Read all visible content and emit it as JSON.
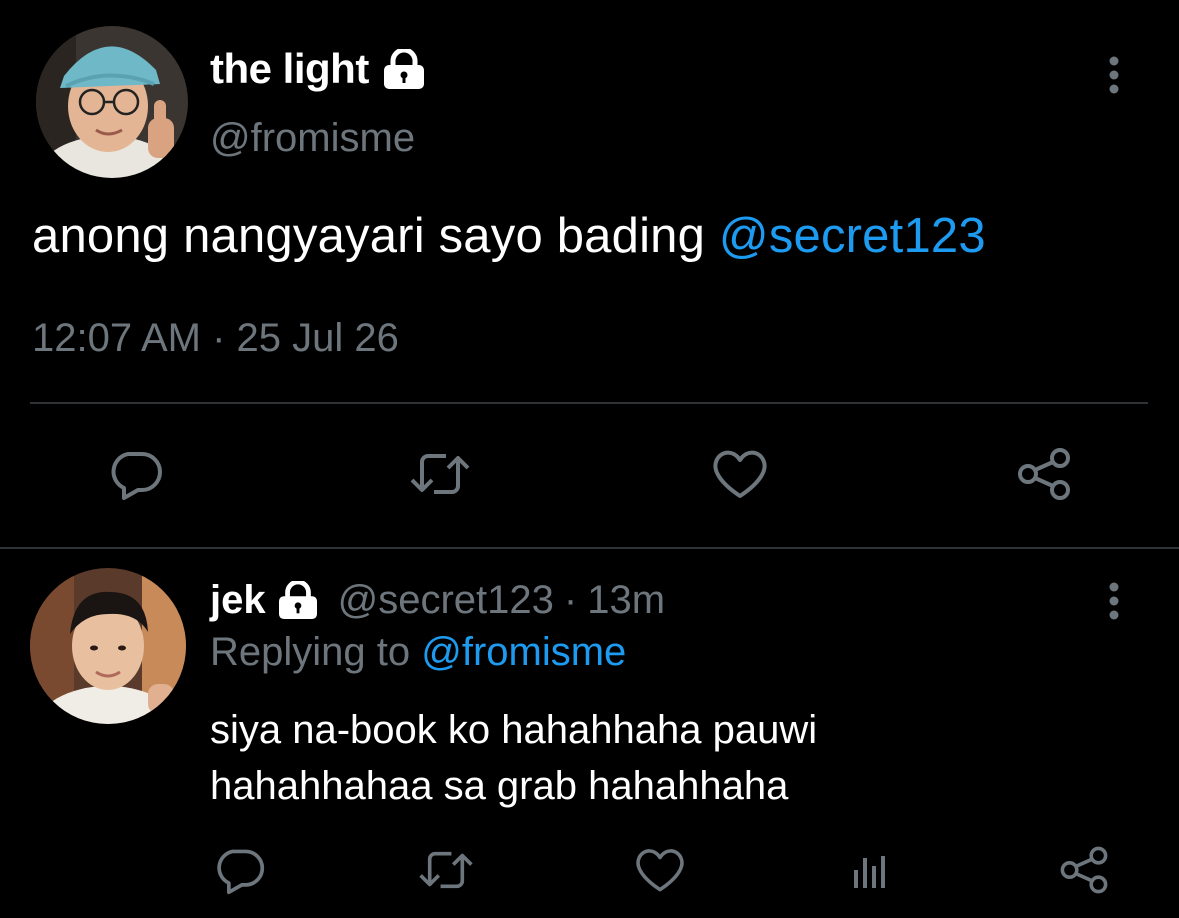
{
  "main_tweet": {
    "display_name": "the light",
    "handle": "@fromisme",
    "text_prefix": "anong nangyayari sayo bading ",
    "mention": "@secret123",
    "timestamp": "12:07 AM · 25 Jul 26",
    "actions": [
      "reply-icon",
      "retweet-icon",
      "like-icon",
      "share-icon"
    ]
  },
  "reply": {
    "display_name": "jek",
    "handle": "@secret123",
    "separator": "·",
    "time": "13m",
    "replying_to_label": "Replying to ",
    "replying_to_handle": "@fromisme",
    "text_line1": "siya na-book ko hahahhaha pauwi",
    "text_line2": "hahahhahaa sa grab hahahhaha",
    "actions": [
      "reply-icon",
      "retweet-icon",
      "like-icon",
      "analytics-icon",
      "share-icon"
    ]
  },
  "colors": {
    "background": "#000000",
    "text_primary": "#ffffff",
    "text_secondary": "#6e767d",
    "accent": "#1d9bf0",
    "divider": "#2f3336"
  }
}
